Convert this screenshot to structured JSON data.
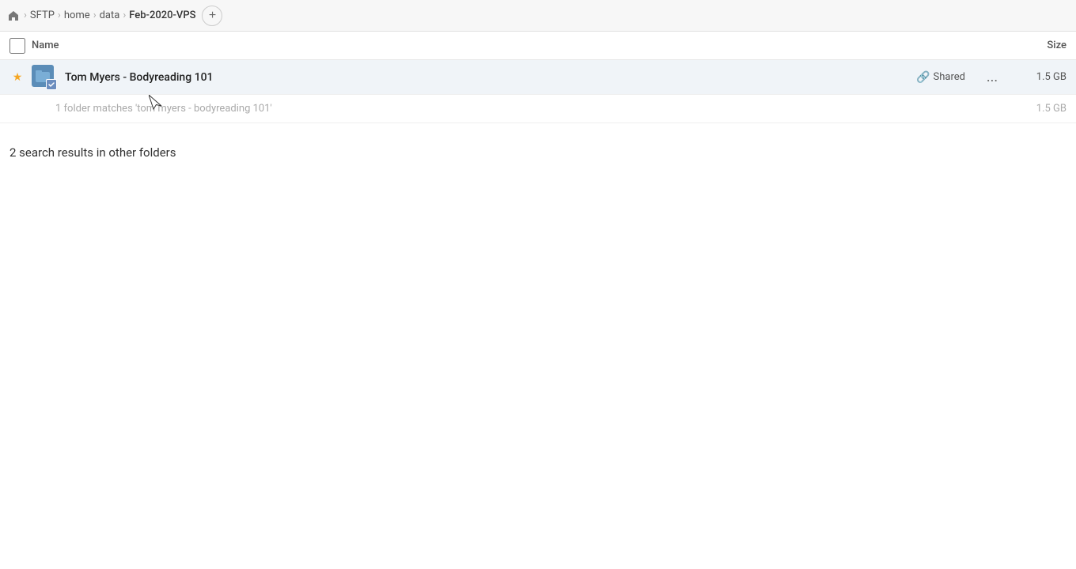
{
  "breadcrumb": {
    "home_label": "home",
    "items": [
      {
        "id": "sftp",
        "label": "SFTP"
      },
      {
        "id": "home",
        "label": "home"
      },
      {
        "id": "data",
        "label": "data"
      },
      {
        "id": "feb2020vps",
        "label": "Feb-2020-VPS"
      }
    ],
    "add_tab_label": "+"
  },
  "file_list": {
    "header": {
      "name_label": "Name",
      "size_label": "Size"
    },
    "rows": [
      {
        "id": "row-1",
        "starred": true,
        "name": "Tom Myers - Bodyreading 101",
        "shared": true,
        "shared_label": "Shared",
        "more_label": "...",
        "size": "1.5 GB"
      }
    ],
    "folder_match_text": "1 folder matches 'tom myers - bodyreading 101'",
    "folder_match_size": "1.5 GB"
  },
  "other_results": {
    "title": "2 search results in other folders"
  }
}
